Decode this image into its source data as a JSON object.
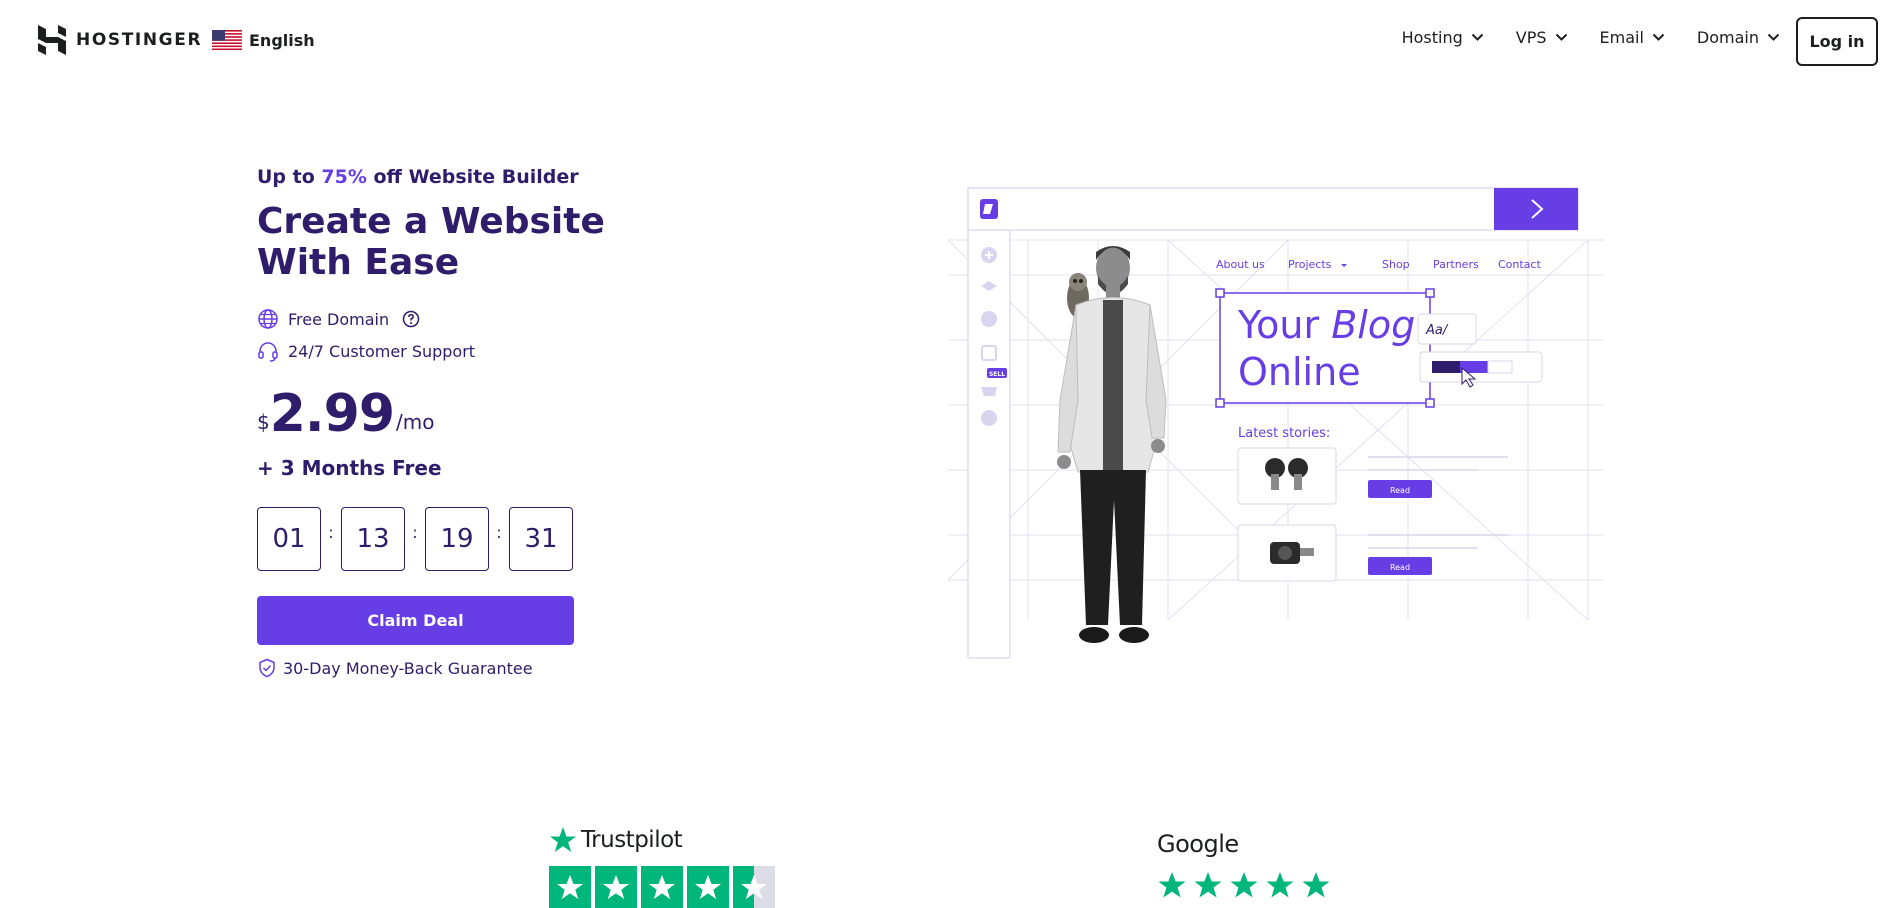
{
  "header": {
    "logo_text": "HOSTINGER",
    "language": "English",
    "nav": [
      "Hosting",
      "VPS",
      "Email",
      "Domain"
    ],
    "login_label": "Log in"
  },
  "hero": {
    "promo_prefix": "Up to ",
    "promo_accent": "75%",
    "promo_suffix": " off Website Builder",
    "headline": "Create a Website With Ease",
    "features": [
      "Free Domain",
      "24/7 Customer Support"
    ],
    "price": {
      "currency": "$",
      "amount": "2.99",
      "period": "/mo"
    },
    "bonus": "+ 3 Months Free",
    "timer": [
      "01",
      "13",
      "19",
      "31"
    ],
    "timer_sep": ":",
    "cta_label": "Claim Deal",
    "guarantee": "30-Day Money-Back Guarantee"
  },
  "illustration": {
    "site_nav": [
      "About us",
      "Projects",
      "Shop",
      "Partners",
      "Contact"
    ],
    "blog_title_1": "Your ",
    "blog_title_italic": "Blog",
    "blog_title_2": "Online",
    "font_tool": "Aa/",
    "sell_badge": "SELL",
    "latest_label": "Latest stories:",
    "read_label": "Read"
  },
  "ratings": {
    "trustpilot_label": "Trustpilot",
    "google_label": "Google"
  },
  "colors": {
    "brand": "#673de6",
    "text": "#2f1c6a",
    "dark": "#1d1e20",
    "trustpilot": "#00b67a"
  }
}
